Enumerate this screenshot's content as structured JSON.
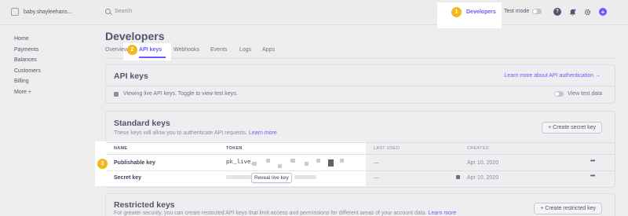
{
  "topbar": {
    "account_name": "baby.shayleehans...",
    "search_placeholder": "Search",
    "developers_label": "Developers",
    "test_mode_label": "Test mode",
    "help_glyph": "?",
    "add_glyph": "+",
    "step1": "1"
  },
  "sidebar": {
    "items": [
      {
        "label": "Home"
      },
      {
        "label": "Payments"
      },
      {
        "label": "Balances"
      },
      {
        "label": "Customers"
      },
      {
        "label": "Billing"
      },
      {
        "label": "More +"
      }
    ]
  },
  "page": {
    "title": "Developers",
    "tabs": [
      {
        "label": "Overview"
      },
      {
        "label": "API keys",
        "active": true
      },
      {
        "label": "Webhooks"
      },
      {
        "label": "Events"
      },
      {
        "label": "Logs"
      },
      {
        "label": "Apps"
      }
    ],
    "step2": "2"
  },
  "api_keys_card": {
    "title": "API keys",
    "link": "Learn more about API authentication →",
    "info": "Viewing live API keys. Toggle to view test keys.",
    "view_test_label": "View test data"
  },
  "standard_keys": {
    "title": "Standard keys",
    "description": "These keys will allow you to authenticate API requests.",
    "learn_more": "Learn more",
    "create_button": "+ Create secret key",
    "columns": [
      "NAME",
      "TOKEN",
      "LAST USED",
      "CREATED"
    ],
    "step3": "3",
    "rows": [
      {
        "name": "Publishable key",
        "token": "pk_live_",
        "last_used": "—",
        "created": "Apr 10, 2020"
      },
      {
        "name": "Secret key",
        "reveal_label": "Reveal live key",
        "last_used": "—",
        "created": "Apr 10, 2020"
      }
    ],
    "row_menu": "•••"
  },
  "restricted_keys": {
    "title": "Restricted keys",
    "description": "For greater security, you can create restricted API keys that limit access and permissions for different areas of your account data.",
    "learn_more": "Learn more",
    "create_button": "+ Create restricted key"
  },
  "colors": {
    "accent": "#635bff",
    "step_badge": "#f3b81a",
    "highlight": "#ffffff"
  }
}
